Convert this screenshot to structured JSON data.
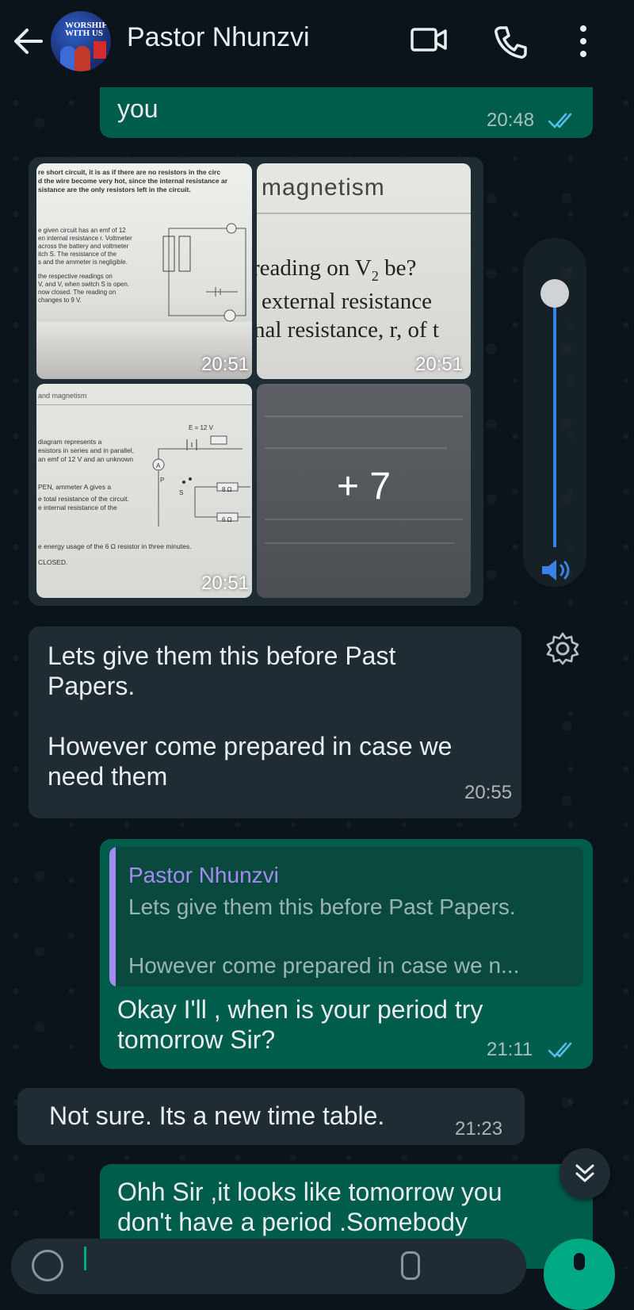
{
  "header": {
    "contact_name": "Pastor Nhunzvi",
    "avatar_text": "WORSHIP WITH US"
  },
  "messages": {
    "m1": {
      "text": "you",
      "time": "20:48"
    },
    "photos": {
      "times": [
        "20:51",
        "20:51",
        "20:51"
      ],
      "more_count": "+ 7",
      "photo1_lines": [
        "re short circuit, it is as if there are no resistors in the circ",
        "d the wire become very hot, since the internal resistance ar",
        "sistance are the only resistors left in the circuit.",
        "e given circuit has an emf of 12",
        "en internal resistance r. Voltmeter",
        "across the battery and voltmeter",
        "itch S. The resistance of the",
        "s and the ammeter is negligible.",
        "the respective readings on",
        "V, and V, when switch S is open.",
        "now closed. The reading on",
        "changes to 9 V."
      ],
      "photo2_title": "magnetism",
      "photo2_lines": [
        "reading on V",
        "2",
        " be?",
        "external resistance",
        "nal resistance, r, of t"
      ],
      "photo3_lines": [
        "and magnetism",
        "diagram represents a",
        "esistors in series and in parallel,",
        "an emf of 12 V and an unknown",
        "PEN, ammeter A gives a",
        "e total resistance of the circuit.",
        "e internal resistance of the",
        "e energy usage of the 6 Ω resistor in three minutes.",
        "CLOSED."
      ],
      "photo3_labels": [
        "E = 12 V",
        "8 Ω",
        "6 Ω",
        "A",
        "S",
        "P"
      ]
    },
    "m2": {
      "text": "Lets give them this before Past\nPapers.\n\nHowever come prepared in case we\nneed them",
      "time": "20:55"
    },
    "m3": {
      "reply_author": "Pastor Nhunzvi",
      "reply_line1": "Lets give them this before Past Papers.",
      "reply_line2": "However come prepared in case we n...",
      "text": "Okay I'll , when is your period try\ntomorrow Sir?",
      "time": "21:11"
    },
    "m4": {
      "text": "Not sure. Its a new time table.",
      "time": "21:23"
    },
    "m5": {
      "text": "Ohh Sir ,it looks like tomorrow you\ndon't have a period .Somebody"
    }
  },
  "colors": {
    "outgoing": "#005c4b",
    "incoming": "#202c33",
    "read_ticks": "#53bdeb",
    "accent": "#00a884"
  },
  "icons": [
    "back-arrow-icon",
    "video-call-icon",
    "voice-call-icon",
    "more-options-icon",
    "volume-icon",
    "settings-gear-icon",
    "scroll-down-icon",
    "mic-icon"
  ]
}
